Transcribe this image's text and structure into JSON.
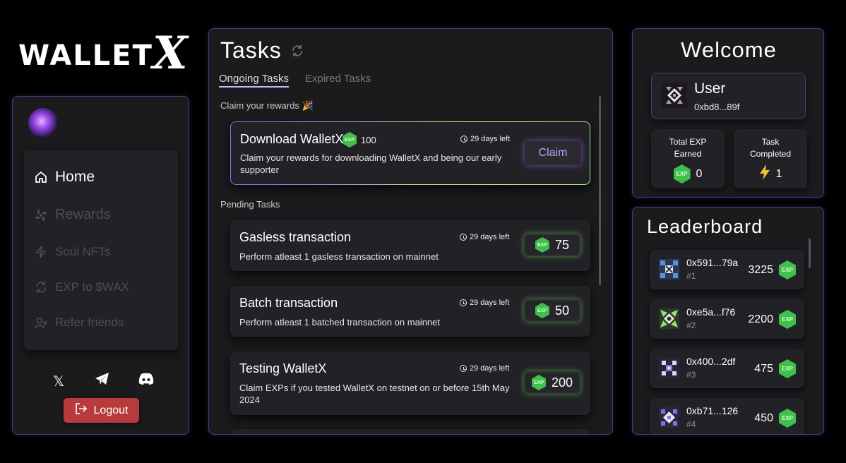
{
  "brand": {
    "logo_text": "WALLET",
    "logo_mark": "X"
  },
  "sidebar": {
    "avatar": "user-avatar",
    "nav": [
      {
        "label": "Home",
        "icon": "home-icon",
        "active": true
      },
      {
        "label": "Rewards",
        "icon": "rewards-icon",
        "active": false
      },
      {
        "label": "Soul NFTs",
        "icon": "lightning-icon",
        "active": false
      },
      {
        "label": "EXP to $WAX",
        "icon": "exchange-icon",
        "active": false
      },
      {
        "label": "Refer friends",
        "icon": "user-plus-icon",
        "active": false
      }
    ],
    "socials": [
      {
        "icon": "x-icon",
        "glyph": "𝕏"
      },
      {
        "icon": "telegram-icon",
        "glyph": "➤"
      },
      {
        "icon": "discord-icon",
        "glyph": "◉"
      }
    ],
    "logout_label": "Logout"
  },
  "tasks": {
    "title": "Tasks",
    "tabs": [
      {
        "label": "Ongoing Tasks",
        "active": true
      },
      {
        "label": "Expired Tasks",
        "active": false
      }
    ],
    "claim_section": "Claim your rewards 🎉",
    "featured": {
      "title": "Download WalletX",
      "exp_badge": "EXP",
      "reward": "100",
      "days_left": "29 days left",
      "description": "Claim your rewards for downloading WalletX and being our early supporter",
      "action": "Claim"
    },
    "pending_section": "Pending Tasks",
    "pending": [
      {
        "title": "Gasless transaction",
        "days_left": "29 days left",
        "description": "Perform atleast 1 gasless transaction on mainnet",
        "reward": "75",
        "exp_badge": "EXP"
      },
      {
        "title": "Batch transaction",
        "days_left": "29 days left",
        "description": "Perform atleast 1 batched transaction on mainnet",
        "reward": "50",
        "exp_badge": "EXP"
      },
      {
        "title": "Testing WalletX",
        "days_left": "29 days left",
        "description": "Claim EXPs if you tested WalletX on testnet on or before 15th May 2024",
        "reward": "200",
        "exp_badge": "EXP"
      }
    ]
  },
  "welcome": {
    "title": "Welcome",
    "user_name": "User",
    "user_address": "0xbd8...89f",
    "stats": [
      {
        "label_line1": "Total EXP",
        "label_line2": "Earned",
        "value": "0",
        "icon": "exp-icon",
        "badge": "EXP"
      },
      {
        "label_line1": "Task",
        "label_line2": "Completed",
        "value": "1",
        "icon": "lightning-icon"
      }
    ]
  },
  "leaderboard": {
    "title": "Leaderboard",
    "rows": [
      {
        "address": "0x591...79a",
        "rank": "#1",
        "score": "3225",
        "badge": "EXP",
        "color": "#4a7fd4"
      },
      {
        "address": "0xe5a...f76",
        "rank": "#2",
        "score": "2200",
        "badge": "EXP",
        "color": "#8fd46a"
      },
      {
        "address": "0x400...2df",
        "rank": "#3",
        "score": "475",
        "badge": "EXP",
        "color": "#6a6ad4"
      },
      {
        "address": "0xb71...126",
        "rank": "#4",
        "score": "450",
        "badge": "EXP",
        "color": "#7a5ad8"
      }
    ]
  }
}
